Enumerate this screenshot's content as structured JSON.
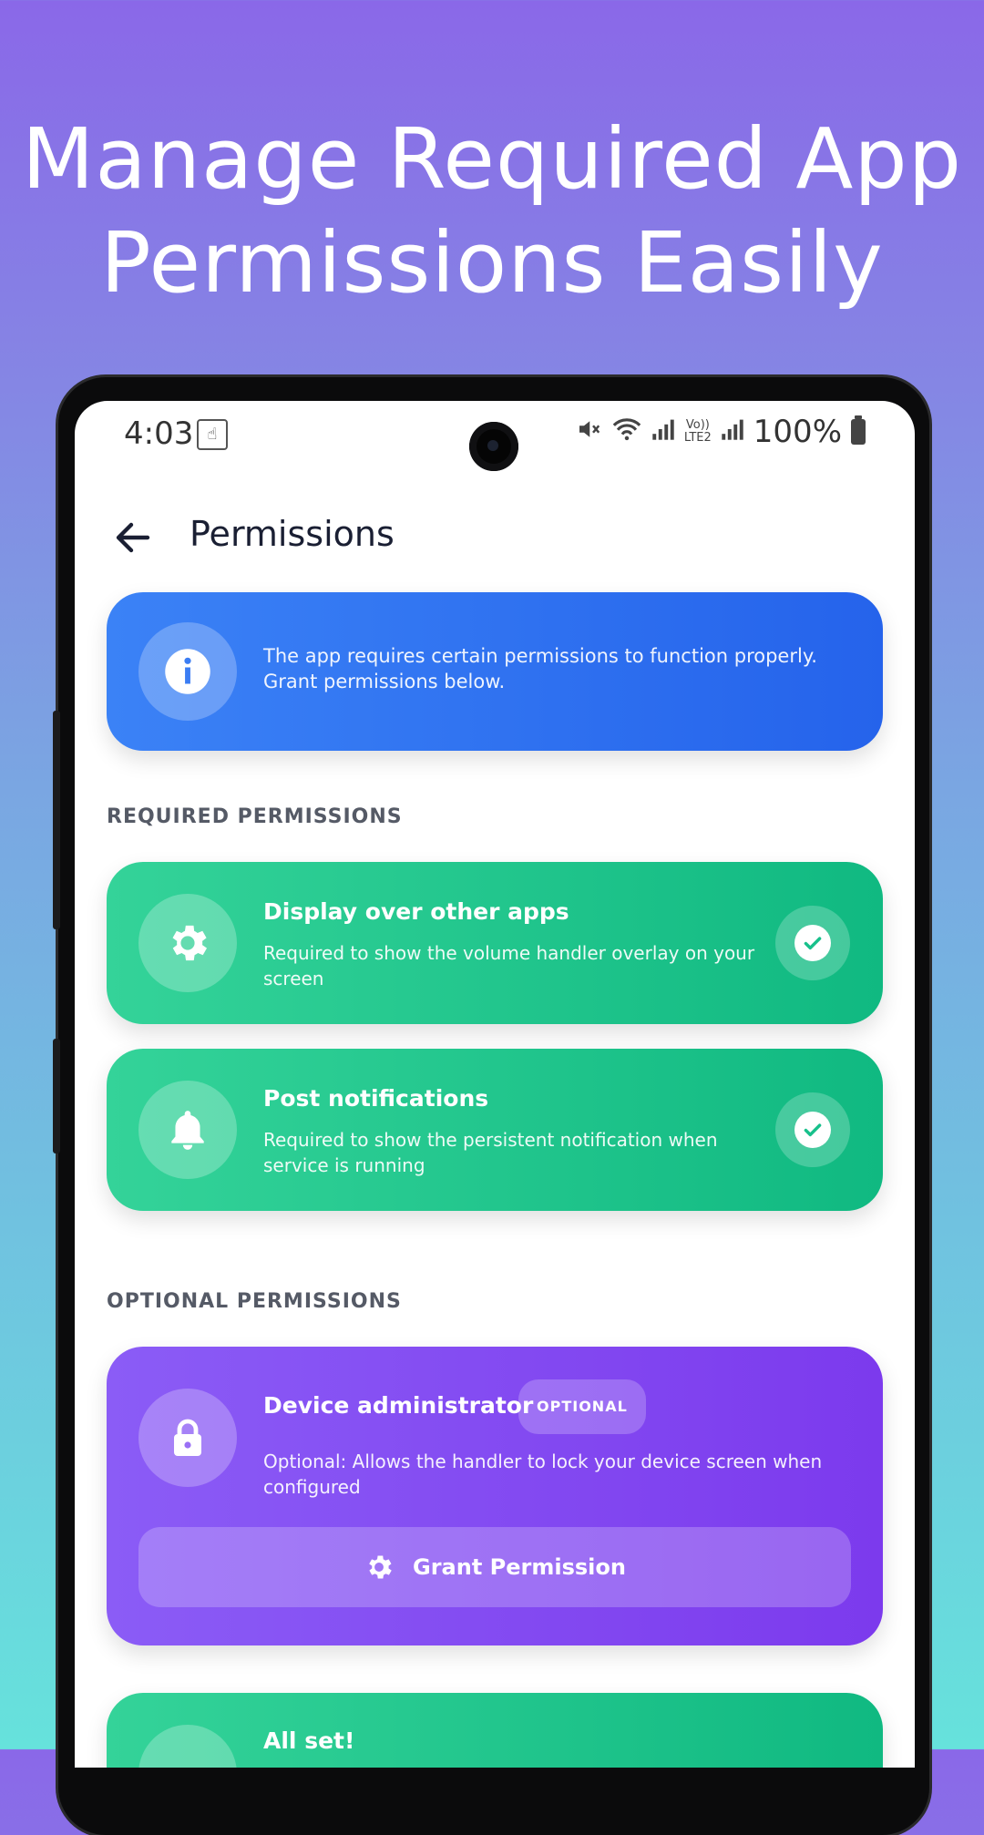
{
  "headline": {
    "line1": "Manage Required App",
    "line2": "Permissions Easily"
  },
  "status_bar": {
    "time": "4:03",
    "battery": "100%",
    "network": "LTE2",
    "icons": [
      "touch-icon",
      "mute-icon",
      "wifi-icon",
      "signal-icon",
      "volte-icon",
      "signal-icon",
      "battery-icon"
    ]
  },
  "app_bar": {
    "title": "Permissions",
    "back_icon": "arrow-left-icon"
  },
  "info_card": {
    "text_line1": "The app requires certain permissions to function properly.",
    "text_line2": "Grant permissions below.",
    "icon": "info-icon"
  },
  "required_section": {
    "label": "REQUIRED PERMISSIONS",
    "items": [
      {
        "title": "Display over other apps",
        "desc_line1": "Required to show the volume handler overlay on your",
        "desc_line2": "screen",
        "icon": "gear-icon",
        "status_icon": "check-icon"
      },
      {
        "title": "Post notifications",
        "desc_line1": "Required to show the persistent notification when",
        "desc_line2": "service is running",
        "icon": "bell-icon",
        "status_icon": "check-icon"
      }
    ]
  },
  "optional_section": {
    "label": "OPTIONAL PERMISSIONS",
    "items": [
      {
        "title": "Device administrator",
        "badge": "OPTIONAL",
        "desc_line1": "Optional: Allows the handler to lock your device screen when",
        "desc_line2": "configured",
        "icon": "lock-icon",
        "button_label": "Grant Permission",
        "button_icon": "gear-icon"
      }
    ]
  },
  "footer_card": {
    "title": "All set!"
  },
  "colors": {
    "info": "#2563eb",
    "green": "#10b981",
    "purple": "#7c3aed",
    "section_label": "#555a66"
  }
}
